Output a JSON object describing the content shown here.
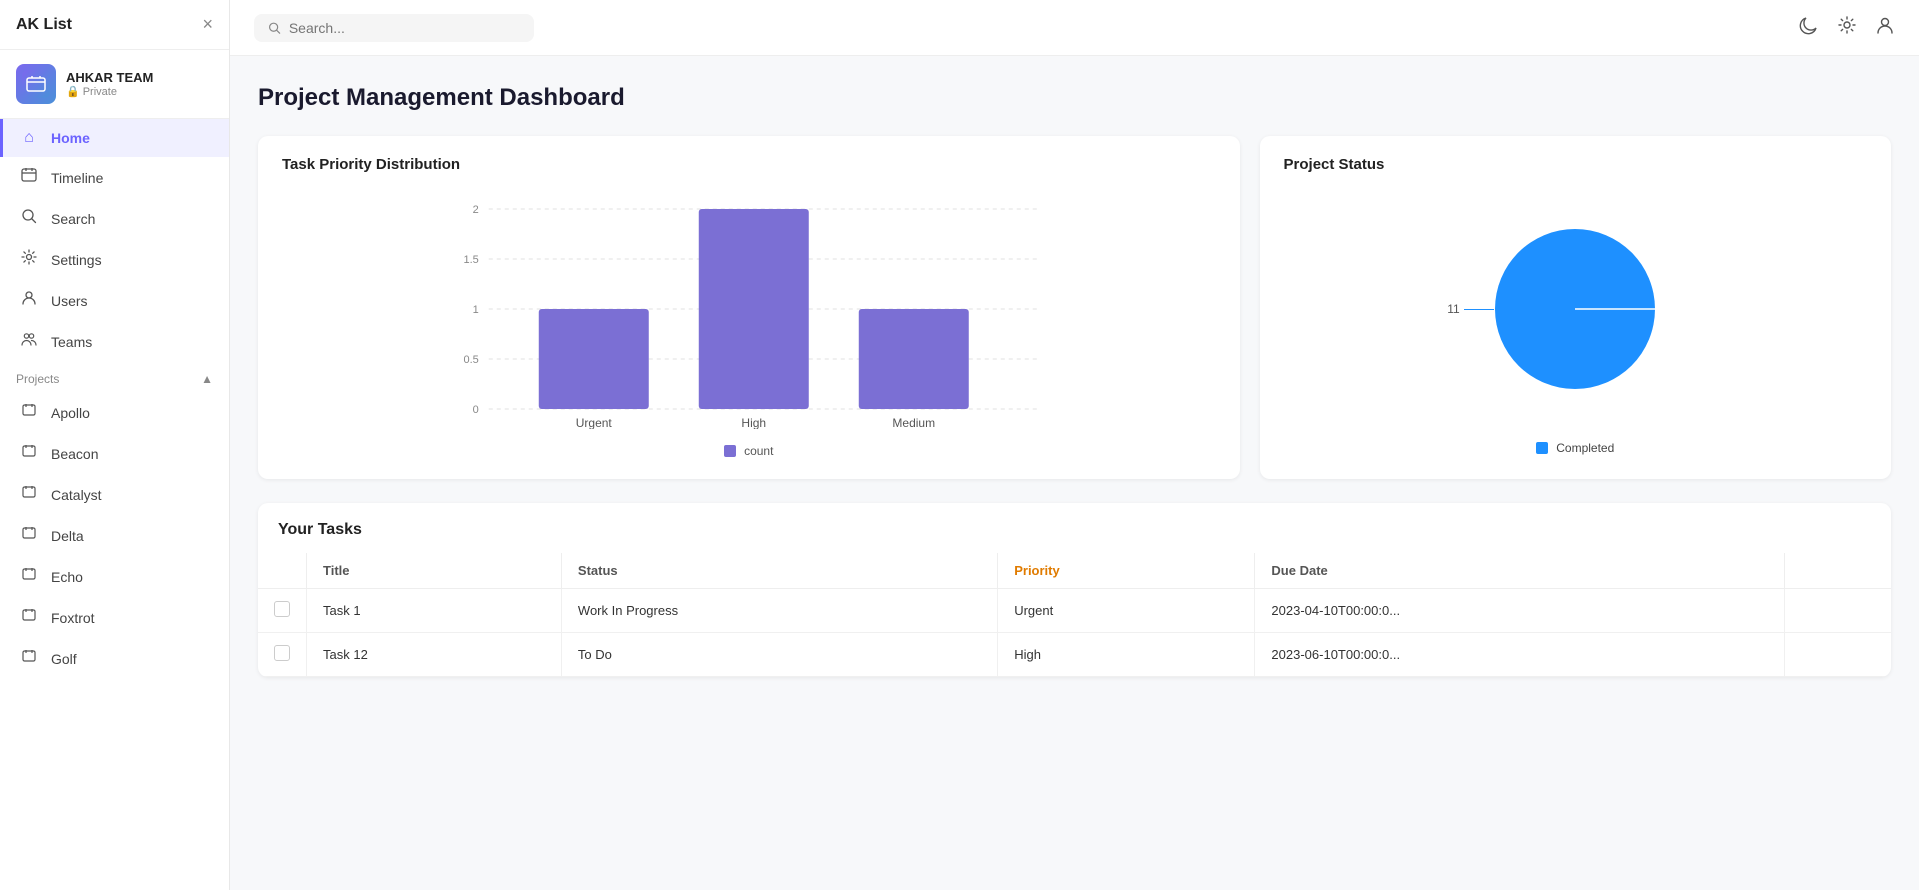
{
  "app": {
    "title": "AK List",
    "close_icon": "×"
  },
  "team": {
    "name": "AHKAR TEAM",
    "privacy": "Private",
    "lock_icon": "🔒",
    "avatar_emoji": "📋"
  },
  "nav": {
    "items": [
      {
        "id": "home",
        "label": "Home",
        "icon": "⌂",
        "active": true
      },
      {
        "id": "timeline",
        "label": "Timeline",
        "icon": "📅",
        "active": false
      },
      {
        "id": "search",
        "label": "Search",
        "icon": "🔍",
        "active": false
      },
      {
        "id": "settings",
        "label": "Settings",
        "icon": "⚙",
        "active": false
      },
      {
        "id": "users",
        "label": "Users",
        "icon": "👤",
        "active": false
      },
      {
        "id": "teams",
        "label": "Teams",
        "icon": "👥",
        "active": false
      }
    ],
    "projects_label": "Projects",
    "projects_chevron": "▲",
    "projects": [
      {
        "id": "apollo",
        "label": "Apollo"
      },
      {
        "id": "beacon",
        "label": "Beacon"
      },
      {
        "id": "catalyst",
        "label": "Catalyst"
      },
      {
        "id": "delta",
        "label": "Delta"
      },
      {
        "id": "echo",
        "label": "Echo"
      },
      {
        "id": "foxtrot",
        "label": "Foxtrot"
      },
      {
        "id": "golf",
        "label": "Golf"
      }
    ]
  },
  "topbar": {
    "search_placeholder": "Search...",
    "search_label": "Search _",
    "icons": {
      "moon": "🌙",
      "gear": "⚙",
      "user": "👤"
    }
  },
  "dashboard": {
    "title": "Project Management Dashboard",
    "bar_chart": {
      "title": "Task Priority Distribution",
      "y_labels": [
        "2",
        "1.5",
        "1",
        "0.5",
        "0"
      ],
      "bars": [
        {
          "label": "Urgent",
          "value": 1,
          "height_pct": 50
        },
        {
          "label": "High",
          "value": 2,
          "height_pct": 100
        },
        {
          "label": "Medium",
          "value": 1,
          "height_pct": 50
        }
      ],
      "legend_label": "count",
      "legend_color": "#7b6fd4"
    },
    "pie_chart": {
      "title": "Project Status",
      "label_value": "11",
      "legend_label": "Completed",
      "legend_color": "#1e90ff"
    },
    "tasks": {
      "title": "Your Tasks",
      "columns": [
        "",
        "Title",
        "Status",
        "Priority",
        "Due Date"
      ],
      "rows": [
        {
          "title": "Task 1",
          "status": "Work In Progress",
          "priority": "Urgent",
          "due_date": "2023-04-10T00:00:0...",
          "priority_class": "urgent"
        },
        {
          "title": "Task 12",
          "status": "To Do",
          "priority": "High",
          "due_date": "2023-06-10T00:00:0...",
          "priority_class": "high"
        }
      ]
    }
  },
  "colors": {
    "bar_fill": "#7b6fd4",
    "pie_fill": "#1e90ff",
    "accent": "#6c63ff"
  }
}
